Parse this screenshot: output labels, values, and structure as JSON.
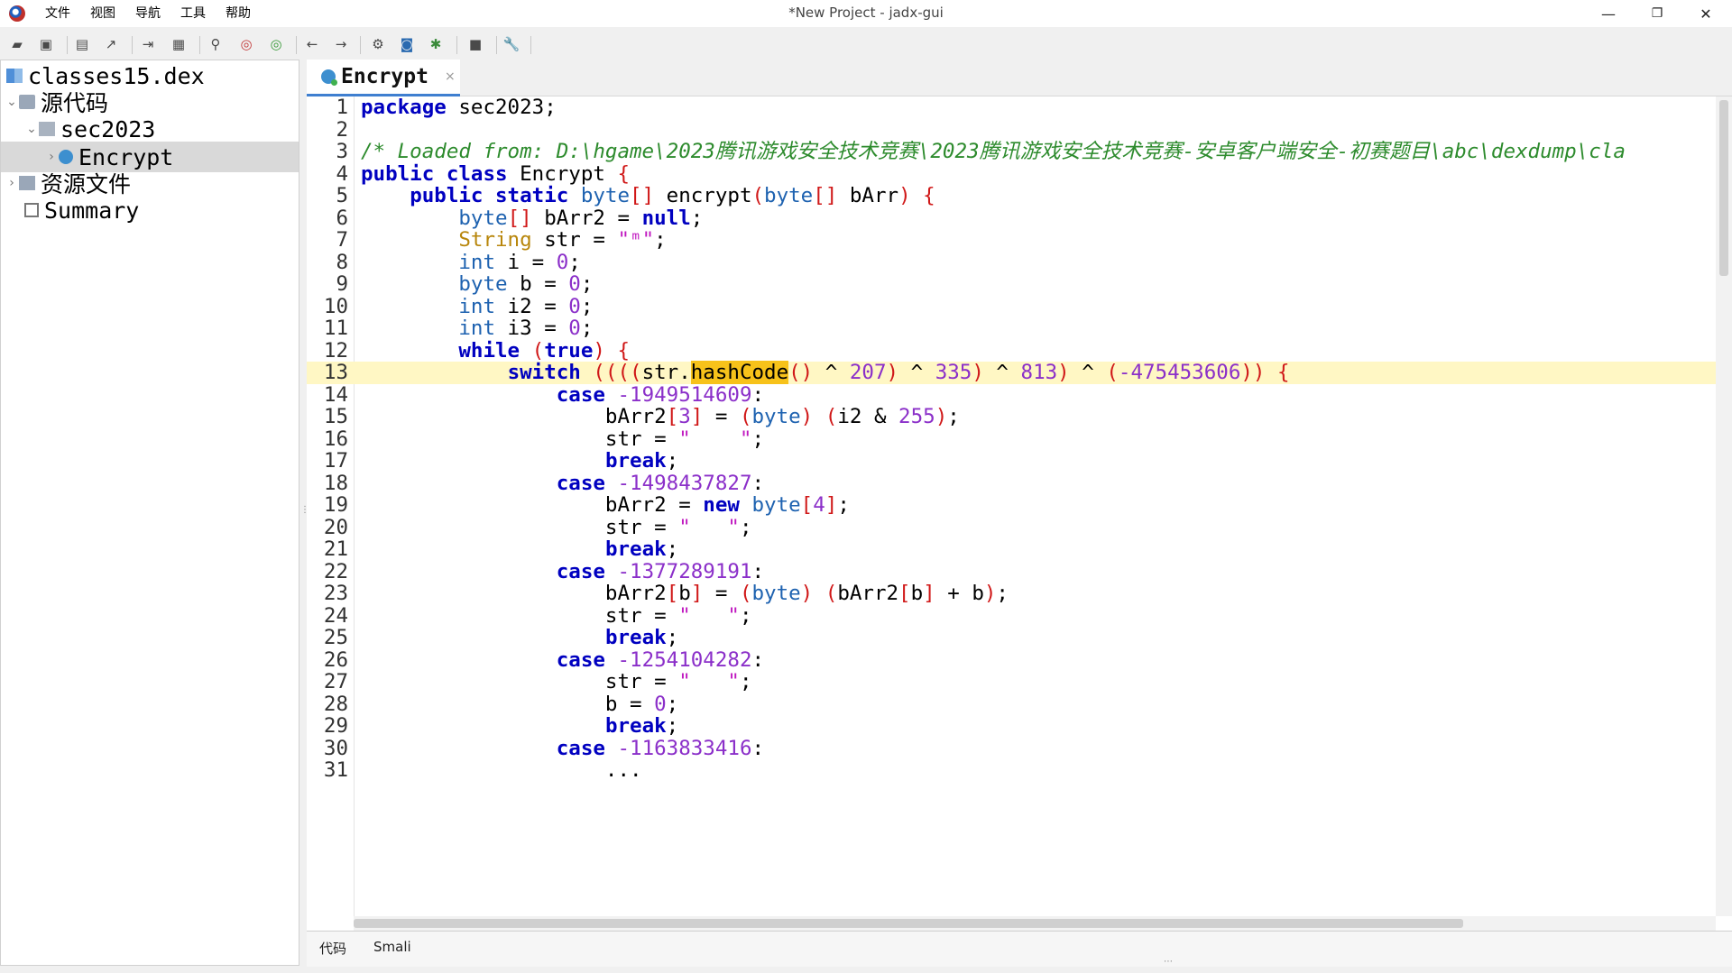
{
  "window": {
    "title": "*New Project - jadx-gui",
    "menu": [
      "文件",
      "视图",
      "导航",
      "工具",
      "帮助"
    ],
    "controls": {
      "minimize": "—",
      "maximize": "❐",
      "close": "✕"
    }
  },
  "toolbar": {
    "icons": [
      "open-file-icon",
      "add-files-icon",
      "save-icon",
      "export-icon",
      "sync-tree-icon",
      "flatten-packages-icon",
      "search-icon",
      "find-class-icon",
      "find-usage-icon",
      "back-icon",
      "forward-icon",
      "deobfuscation-icon",
      "quark-icon",
      "debug-icon",
      "log-icon",
      "preferences-icon"
    ]
  },
  "sidebar": {
    "items": [
      {
        "label": "classes15.dex",
        "level": 0,
        "chevron": "",
        "icon": "dex-file-icon"
      },
      {
        "label": "源代码",
        "level": 0,
        "chevron": "⌄",
        "icon": "source-root-icon"
      },
      {
        "label": "sec2023",
        "level": 1,
        "chevron": "⌄",
        "icon": "package-icon"
      },
      {
        "label": "Encrypt",
        "level": 2,
        "chevron": "›",
        "icon": "class-icon",
        "selected": true
      },
      {
        "label": "资源文件",
        "level": 0,
        "chevron": "›",
        "icon": "resources-folder-icon"
      },
      {
        "label": "Summary",
        "level": 0,
        "chevron": "",
        "icon": "summary-icon"
      }
    ]
  },
  "editor": {
    "tab": {
      "label": "Encrypt",
      "close": "×"
    },
    "highlighted_line": 13,
    "lines": [
      {
        "n": "1",
        "html": "<span class='kw'>package</span> sec2023;"
      },
      {
        "n": "2",
        "html": ""
      },
      {
        "n": "3",
        "html": "<span class='cm'>/* Loaded from: D:\\hgame\\2023腾讯游戏安全技术竞赛\\2023腾讯游戏安全技术竞赛-安卓客户端安全-初赛题目\\abc\\dexdump\\cla</span>"
      },
      {
        "n": "4",
        "html": "<span class='kw'>public class</span> Encrypt <span class='br'>{</span>"
      },
      {
        "n": "5",
        "html": "    <span class='kw'>public static</span> <span class='ty'>byte</span><span class='br'>[]</span> encrypt<span class='br'>(</span><span class='ty'>byte</span><span class='br'>[]</span> bArr<span class='br'>)</span> <span class='br'>{</span>"
      },
      {
        "n": "6",
        "html": "        <span class='ty'>byte</span><span class='br'>[]</span> bArr2 = <span class='kw'>null</span>;"
      },
      {
        "n": "7",
        "html": "        <span class='cls'>String</span> str = <span class='glyph'>\"ᵐ\"</span>;"
      },
      {
        "n": "8",
        "html": "        <span class='ty'>int</span> i = <span class='num'>0</span>;"
      },
      {
        "n": "9",
        "html": "        <span class='ty'>byte</span> b = <span class='num'>0</span>;"
      },
      {
        "n": "10",
        "html": "        <span class='ty'>int</span> i2 = <span class='num'>0</span>;"
      },
      {
        "n": "11",
        "html": "        <span class='ty'>int</span> i3 = <span class='num'>0</span>;"
      },
      {
        "n": "12",
        "html": "        <span class='kw'>while</span> <span class='br'>(</span><span class='kw'>true</span><span class='br'>)</span> <span class='br'>{</span>"
      },
      {
        "n": "13",
        "html": "            <span class='kw'>switch</span> <span class='br'>((((</span>str.<span class='mark'>hashCode</span><span class='br'>()</span> ^ <span class='num'>207</span><span class='br'>)</span> ^ <span class='num'>335</span><span class='br'>)</span> ^ <span class='num'>813</span><span class='br'>)</span> ^ <span class='br'>(</span><span class='num'>-475453606</span><span class='br'>))</span> <span class='br'>{</span>"
      },
      {
        "n": "14",
        "html": "                <span class='kw'>case</span> <span class='num'>-1949514609</span>:"
      },
      {
        "n": "15",
        "html": "                    bArr2<span class='br'>[</span><span class='num'>3</span><span class='br'>]</span> = <span class='br'>(</span><span class='ty'>byte</span><span class='br'>)</span> <span class='br'>(</span>i2 &amp; <span class='num'>255</span><span class='br'>)</span>;"
      },
      {
        "n": "16",
        "html": "                    str = <span class='glyph'>\"    \"</span>;"
      },
      {
        "n": "17",
        "html": "                    <span class='kw'>break</span>;"
      },
      {
        "n": "18",
        "html": "                <span class='kw'>case</span> <span class='num'>-1498437827</span>:"
      },
      {
        "n": "19",
        "html": "                    bArr2 = <span class='kw'>new</span> <span class='ty'>byte</span><span class='br'>[</span><span class='num'>4</span><span class='br'>]</span>;"
      },
      {
        "n": "20",
        "html": "                    str = <span class='glyph'>\"   \"</span>;"
      },
      {
        "n": "21",
        "html": "                    <span class='kw'>break</span>;"
      },
      {
        "n": "22",
        "html": "                <span class='kw'>case</span> <span class='num'>-1377289191</span>:"
      },
      {
        "n": "23",
        "html": "                    bArr2<span class='br'>[</span>b<span class='br'>]</span> = <span class='br'>(</span><span class='ty'>byte</span><span class='br'>)</span> <span class='br'>(</span>bArr2<span class='br'>[</span>b<span class='br'>]</span> + b<span class='br'>)</span>;"
      },
      {
        "n": "24",
        "html": "                    str = <span class='glyph'>\"   \"</span>;"
      },
      {
        "n": "25",
        "html": "                    <span class='kw'>break</span>;"
      },
      {
        "n": "26",
        "html": "                <span class='kw'>case</span> <span class='num'>-1254104282</span>:"
      },
      {
        "n": "27",
        "html": "                    str = <span class='glyph'>\"   \"</span>;"
      },
      {
        "n": "28",
        "html": "                    b = <span class='num'>0</span>;"
      },
      {
        "n": "29",
        "html": "                    <span class='kw'>break</span>;"
      },
      {
        "n": "30",
        "html": "                <span class='kw'>case</span> <span class='num'>-1163833416</span>:"
      },
      {
        "n": "31",
        "html": "                    ..."
      }
    ]
  },
  "bottom_tabs": [
    "代码",
    "Smali"
  ]
}
